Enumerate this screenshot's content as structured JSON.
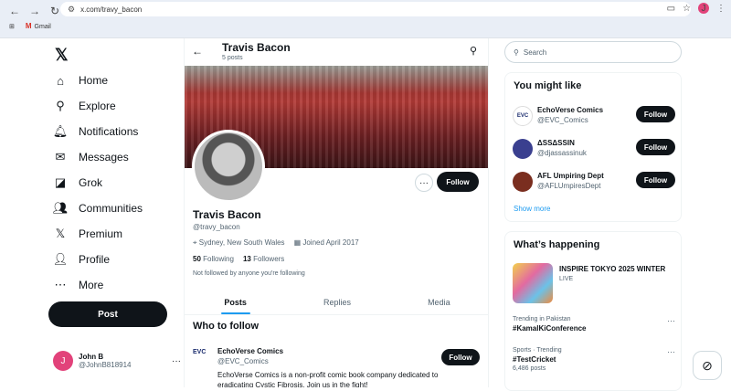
{
  "browser": {
    "url": "x.com/travy_bacon",
    "bookmark": "Gmail",
    "profile_initial": "J"
  },
  "sidebar": {
    "logo": "𝕏",
    "items": [
      {
        "label": "Home",
        "icon": "home-icon",
        "glyph": "⌂"
      },
      {
        "label": "Explore",
        "icon": "search-icon",
        "glyph": "⚲"
      },
      {
        "label": "Notifications",
        "icon": "bell-icon",
        "glyph": "🔔︎"
      },
      {
        "label": "Messages",
        "icon": "mail-icon",
        "glyph": "✉"
      },
      {
        "label": "Grok",
        "icon": "grok-icon",
        "glyph": "◪"
      },
      {
        "label": "Communities",
        "icon": "people-icon",
        "glyph": "👥︎"
      },
      {
        "label": "Premium",
        "icon": "x-premium-icon",
        "glyph": "𝕏"
      },
      {
        "label": "Profile",
        "icon": "person-icon",
        "glyph": "👤︎"
      },
      {
        "label": "More",
        "icon": "more-circle-icon",
        "glyph": "⋯"
      }
    ],
    "post_label": "Post",
    "account": {
      "initial": "J",
      "name": "John B",
      "handle": "@JohnB818914"
    }
  },
  "profile": {
    "header_name": "Travis Bacon",
    "post_count": "5 posts",
    "name": "Travis Bacon",
    "handle": "@travy_bacon",
    "location": "Sydney, New South Wales",
    "joined": "Joined April 2017",
    "following_count": "50",
    "following_label": "Following",
    "followers_count": "13",
    "followers_label": "Followers",
    "follow_note": "Not followed by anyone you're following",
    "follow_label": "Follow",
    "tabs": [
      "Posts",
      "Replies",
      "Media"
    ]
  },
  "who_to_follow": {
    "title": "Who to follow",
    "name": "EchoVerse Comics",
    "handle": "@EVC_Comics",
    "logo_text": "EVC",
    "follow_label": "Follow",
    "bio": "EchoVerse Comics is a non-profit comic book company dedicated to eradicating Cystic Fibrosis. Join us in the fight!"
  },
  "right": {
    "search_placeholder": "Search",
    "you_might_like": {
      "title": "You might like",
      "items": [
        {
          "name": "EchoVerse Comics",
          "handle": "@EVC_Comics",
          "color": "#ffffff"
        },
        {
          "name": "ΔSSΔSSIN",
          "handle": "@djassassinuk",
          "color": "#3a3f8f"
        },
        {
          "name": "AFL Umpiring Dept",
          "handle": "@AFLUmpiresDept",
          "color": "#7a2e1f"
        }
      ],
      "follow_label": "Follow",
      "show_more": "Show more"
    },
    "whats_happening": {
      "title": "What’s happening",
      "feature": {
        "title": "INSPIRE TOKYO 2025 WINTER",
        "status": "LIVE"
      },
      "trends": [
        {
          "context": "Trending in Pakistan",
          "title": "#KamalKiConference",
          "posts": ""
        },
        {
          "context": "Sports · Trending",
          "title": "#TestCricket",
          "posts": "6,486 posts"
        }
      ]
    }
  }
}
